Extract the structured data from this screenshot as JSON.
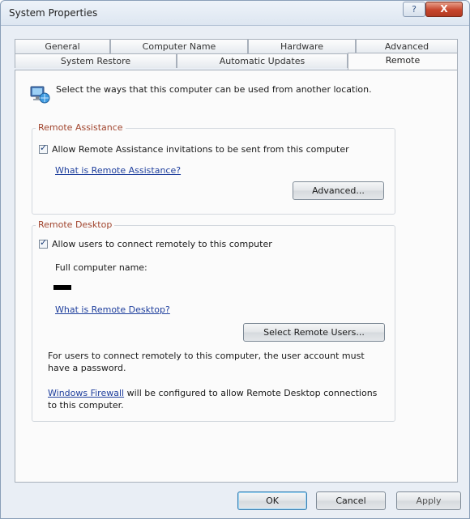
{
  "window": {
    "title": "System Properties",
    "help_label": "?",
    "close_label": "X"
  },
  "tabs": {
    "row1": [
      "General",
      "Computer Name",
      "Hardware",
      "Advanced"
    ],
    "row2": [
      "System Restore",
      "Automatic Updates",
      "Remote"
    ],
    "active": "Remote"
  },
  "intro": {
    "icon": "computer-network-icon",
    "text": "Select the ways that this computer can be used from another location."
  },
  "remote_assistance": {
    "title": "Remote Assistance",
    "checkbox_label": "Allow Remote Assistance invitations to be sent from this computer",
    "checked": true,
    "link": "What is Remote Assistance?",
    "advanced_button": "Advanced..."
  },
  "remote_desktop": {
    "title": "Remote Desktop",
    "checkbox_label": "Allow users to connect remotely to this computer",
    "checked": true,
    "full_name_label": "Full computer name:",
    "link": "What is Remote Desktop?",
    "select_users_button": "Select Remote Users...",
    "password_note": "For users to connect remotely to this computer, the user account must have a password.",
    "firewall_link": "Windows Firewall",
    "firewall_note": " will be configured to allow Remote Desktop connections to this computer."
  },
  "buttons": {
    "ok": "OK",
    "cancel": "Cancel",
    "apply": "Apply"
  },
  "colors": {
    "group_title": "#a1452e",
    "link": "#1f3f9d",
    "close_button": "#c6452c"
  }
}
